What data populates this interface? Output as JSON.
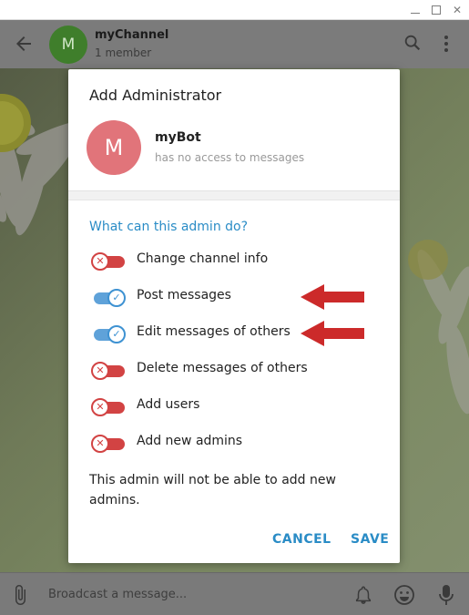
{
  "window": {
    "minimize_glyph": "",
    "maximize_glyph": "",
    "close_glyph": "✕"
  },
  "header": {
    "avatar_letter": "M",
    "chat_title": "myChannel",
    "chat_subtitle": "1 member",
    "icons": [
      "back-arrow-icon",
      "search-icon",
      "more-vert-icon"
    ]
  },
  "composer": {
    "placeholder": "Broadcast a message...",
    "icons": [
      "attach-icon",
      "bell-icon",
      "emoji-icon",
      "mic-icon"
    ]
  },
  "dialog": {
    "title": "Add Administrator",
    "bot": {
      "avatar_letter": "M",
      "name": "myBot",
      "status": "has no access to messages"
    },
    "section_title": "What can this admin do?",
    "permissions": [
      {
        "label": "Change channel info",
        "enabled": false
      },
      {
        "label": "Post messages",
        "enabled": true
      },
      {
        "label": "Edit messages of others",
        "enabled": true
      },
      {
        "label": "Delete messages of others",
        "enabled": false
      },
      {
        "label": "Add users",
        "enabled": false
      },
      {
        "label": "Add new admins",
        "enabled": false
      }
    ],
    "note": "This admin will not be able to add new admins.",
    "cancel_label": "CANCEL",
    "save_label": "SAVE"
  },
  "toggle_glyphs": {
    "on": "✓",
    "off": "✕"
  },
  "colors": {
    "accent": "#2a8cc6",
    "toggle_on": "#5fa2d9",
    "toggle_off": "#d24343",
    "arrow": "#cc2a2a",
    "bot_avatar": "#e1747a",
    "chat_avatar": "#3f7e2b"
  }
}
